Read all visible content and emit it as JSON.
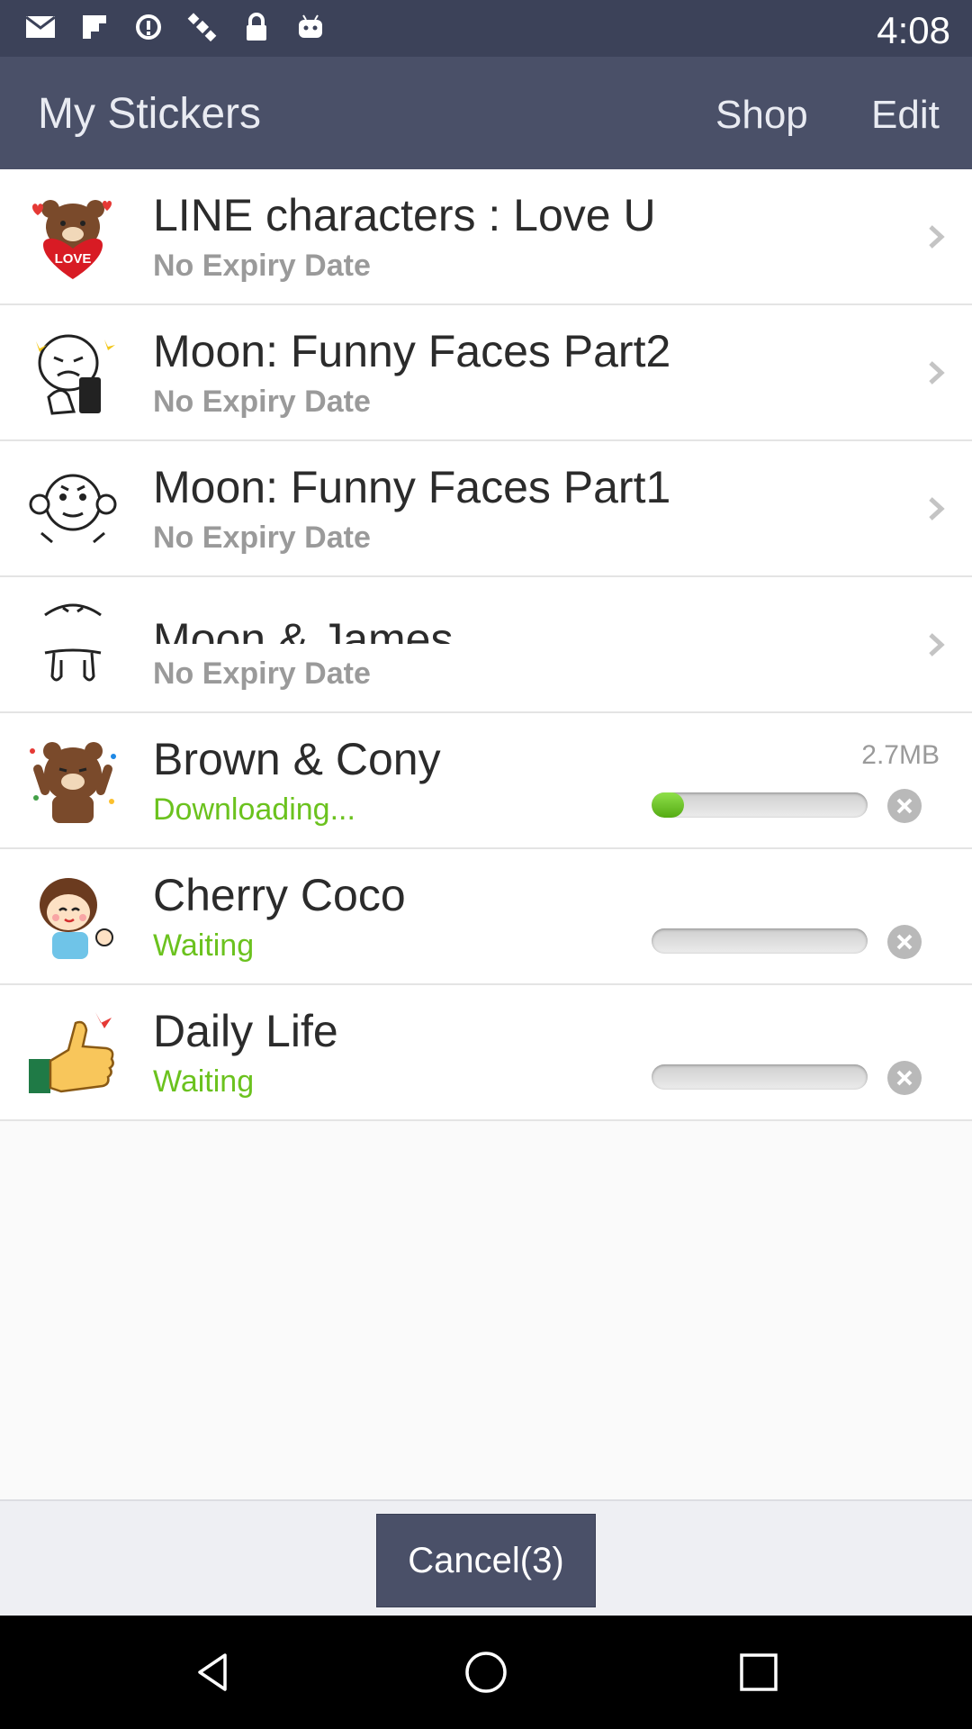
{
  "status_bar": {
    "time": "4:08",
    "icons": [
      "mail-icon",
      "flipboard-icon",
      "data-saver-icon",
      "satellite-icon",
      "lock-icon",
      "android-icon"
    ]
  },
  "app_bar": {
    "title": "My Stickers",
    "shop": "Shop",
    "edit": "Edit"
  },
  "stickers": [
    {
      "name": "LINE characters : Love U",
      "status": "No Expiry Date"
    },
    {
      "name": "Moon: Funny Faces Part2",
      "status": "No Expiry Date"
    },
    {
      "name": "Moon: Funny Faces Part1",
      "status": "No Expiry Date"
    },
    {
      "name": "Moon & James",
      "status": "No Expiry Date"
    }
  ],
  "downloads": [
    {
      "name": "Brown & Cony",
      "status": "Downloading...",
      "size": "2.7MB",
      "progress": 0.15
    },
    {
      "name": "Cherry Coco",
      "status": "Waiting",
      "progress": 0
    },
    {
      "name": "Daily Life",
      "status": "Waiting",
      "progress": 0
    }
  ],
  "footer": {
    "cancel": "Cancel(3)"
  },
  "colors": {
    "header": "#4a5068",
    "status_bar": "#3c4259",
    "accent_green": "#6bc21e"
  }
}
